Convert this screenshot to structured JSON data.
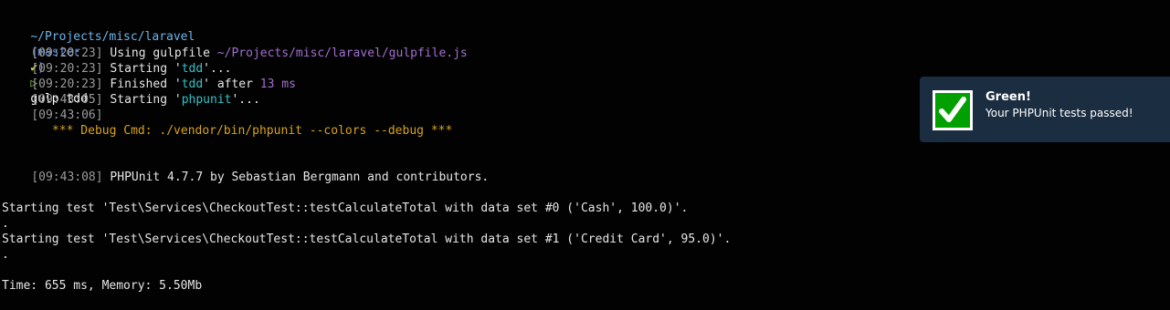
{
  "prompt": {
    "path": "~/Projects/misc/laravel",
    "branch": "(master",
    "check": "✔",
    "branch_close": ")",
    "arrow": "▷",
    "command": "gulp tdd"
  },
  "log": [
    {
      "time": "[09:20:23]",
      "text": " Using gulpfile ",
      "extra": "~/Projects/misc/laravel/gulpfile.js"
    },
    {
      "time": "[09:20:23]",
      "text_before": " Starting '",
      "quoted": "tdd",
      "text_after": "'..."
    },
    {
      "time": "[09:20:23]",
      "text_before": " Finished '",
      "quoted": "tdd",
      "text_after": "' after ",
      "duration": "13 ms"
    },
    {
      "time": "[09:43:05]",
      "text_before": " Starting '",
      "quoted": "phpunit",
      "text_after": "'..."
    },
    {
      "time": "[09:43:06]"
    }
  ],
  "debug_line": "*** Debug Cmd: ./vendor/bin/phpunit --colors --debug ***",
  "phpunit_line": {
    "time": "[09:43:08]",
    "text": " PHPUnit 4.7.7 by Sebastian Bergmann and contributors."
  },
  "test_output": [
    "Starting test 'Test\\Services\\CheckoutTest::testCalculateTotal with data set #0 ('Cash', 100.0)'.",
    ".",
    "Starting test 'Test\\Services\\CheckoutTest::testCalculateTotal with data set #1 ('Credit Card', 95.0)'.",
    "."
  ],
  "summary": "Time: 655 ms, Memory: 5.50Mb",
  "notification": {
    "title": "Green!",
    "body": "Your PHPUnit tests passed!",
    "icon": "checkmark-icon",
    "icon_color": "#00a000"
  },
  "colors": {
    "background": "#020202",
    "notification_bg": "#1b2d40",
    "timestamp": "#9a9a9a",
    "quoted": "#33c2c7",
    "duration": "#a26fd0",
    "debug": "#d8a31a"
  }
}
